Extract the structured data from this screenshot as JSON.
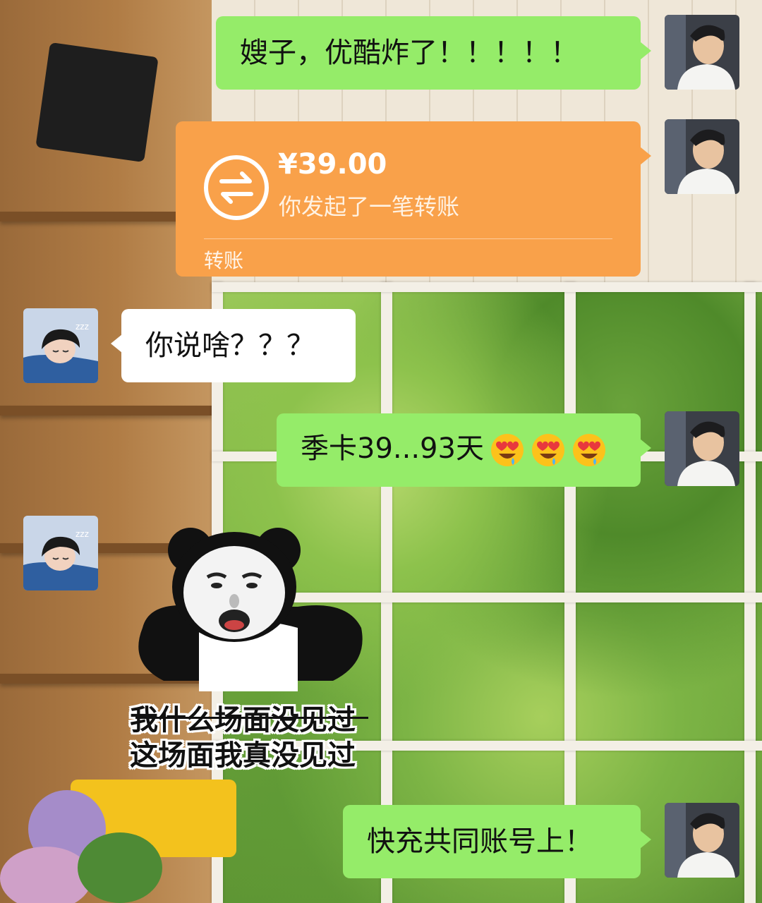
{
  "chat": {
    "messages": [
      {
        "side": "right",
        "type": "text",
        "text": "嫂子，优酷炸了！！！！！"
      },
      {
        "side": "right",
        "type": "transfer",
        "amount": "¥39.00",
        "description": "你发起了一笔转账",
        "footer": "转账"
      },
      {
        "side": "left",
        "type": "text",
        "text": "你说啥？？？"
      },
      {
        "side": "right",
        "type": "text",
        "text": "季卡39...93天",
        "emoji": "smiling-face-with-heart-eyes-drooling",
        "emoji_count": 3
      },
      {
        "side": "left",
        "type": "sticker",
        "sticker": "panda-meme",
        "caption_line1": "我什么场面没见过",
        "caption_line2": "这场面我真没见过"
      },
      {
        "side": "right",
        "type": "text",
        "text": "快充共同账号上！"
      }
    ]
  },
  "colors": {
    "right_bubble": "#95ec69",
    "left_bubble": "#ffffff",
    "transfer_card": "#f9a14a"
  },
  "icons": {
    "transfer": "transfer-arrows-icon",
    "self_avatar": "avatar-boy-white-shirt",
    "other_avatar": "avatar-sleeping-girl"
  }
}
